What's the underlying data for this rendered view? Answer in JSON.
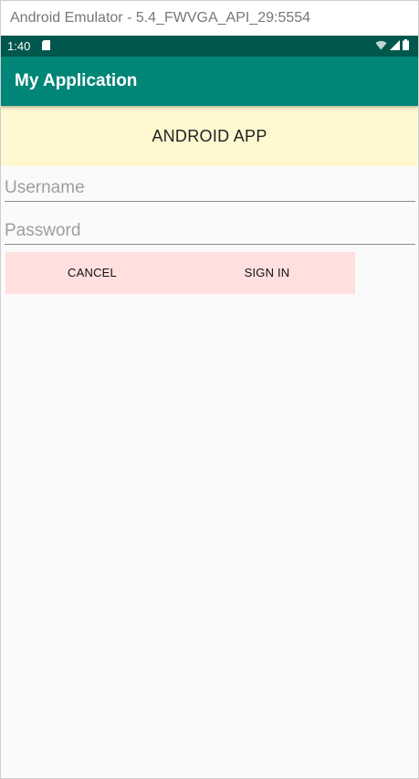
{
  "window": {
    "title": "Android Emulator - 5.4_FWVGA_API_29:5554"
  },
  "status_bar": {
    "time": "1:40",
    "icons": [
      "sd-card-icon",
      "wifi-icon",
      "cell-signal-icon",
      "battery-icon"
    ]
  },
  "app_bar": {
    "title": "My Application"
  },
  "banner": {
    "text": "ANDROID APP"
  },
  "form": {
    "username": {
      "value": "",
      "placeholder": "Username"
    },
    "password": {
      "value": "",
      "placeholder": "Password"
    }
  },
  "buttons": {
    "cancel_label": "CANCEL",
    "signin_label": "SIGN IN"
  },
  "colors": {
    "status_bar": "#00574b",
    "app_bar": "#008577",
    "banner_bg": "#fff8d0",
    "button_row_bg": "#ffe0df",
    "screen_bg": "#fafafa"
  }
}
